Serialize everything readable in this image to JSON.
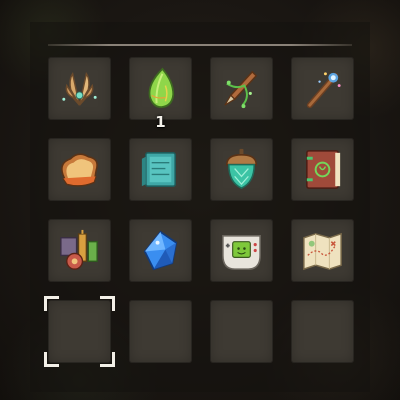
{
  "inventory": {
    "selected_slot": 13,
    "slots": [
      {
        "item": "feather-charm-icon"
      },
      {
        "item": "green-leaf-icon",
        "count": "1"
      },
      {
        "item": "vine-dagger-icon"
      },
      {
        "item": "magic-wand-icon"
      },
      {
        "item": "toast-icon"
      },
      {
        "item": "teal-map-icon"
      },
      {
        "item": "acorn-icon"
      },
      {
        "item": "spellbook-icon"
      },
      {
        "item": "machine-device-icon"
      },
      {
        "item": "blue-crystal-icon"
      },
      {
        "item": "handheld-console-icon"
      },
      {
        "item": "treasure-map-icon"
      },
      {
        "item": ""
      },
      {
        "item": ""
      },
      {
        "item": ""
      },
      {
        "item": ""
      }
    ]
  },
  "colors": {
    "slot": "#3e3a33",
    "cursor": "#f3f0e8",
    "accent_green": "#7ed957",
    "accent_blue": "#4fb6ff"
  }
}
